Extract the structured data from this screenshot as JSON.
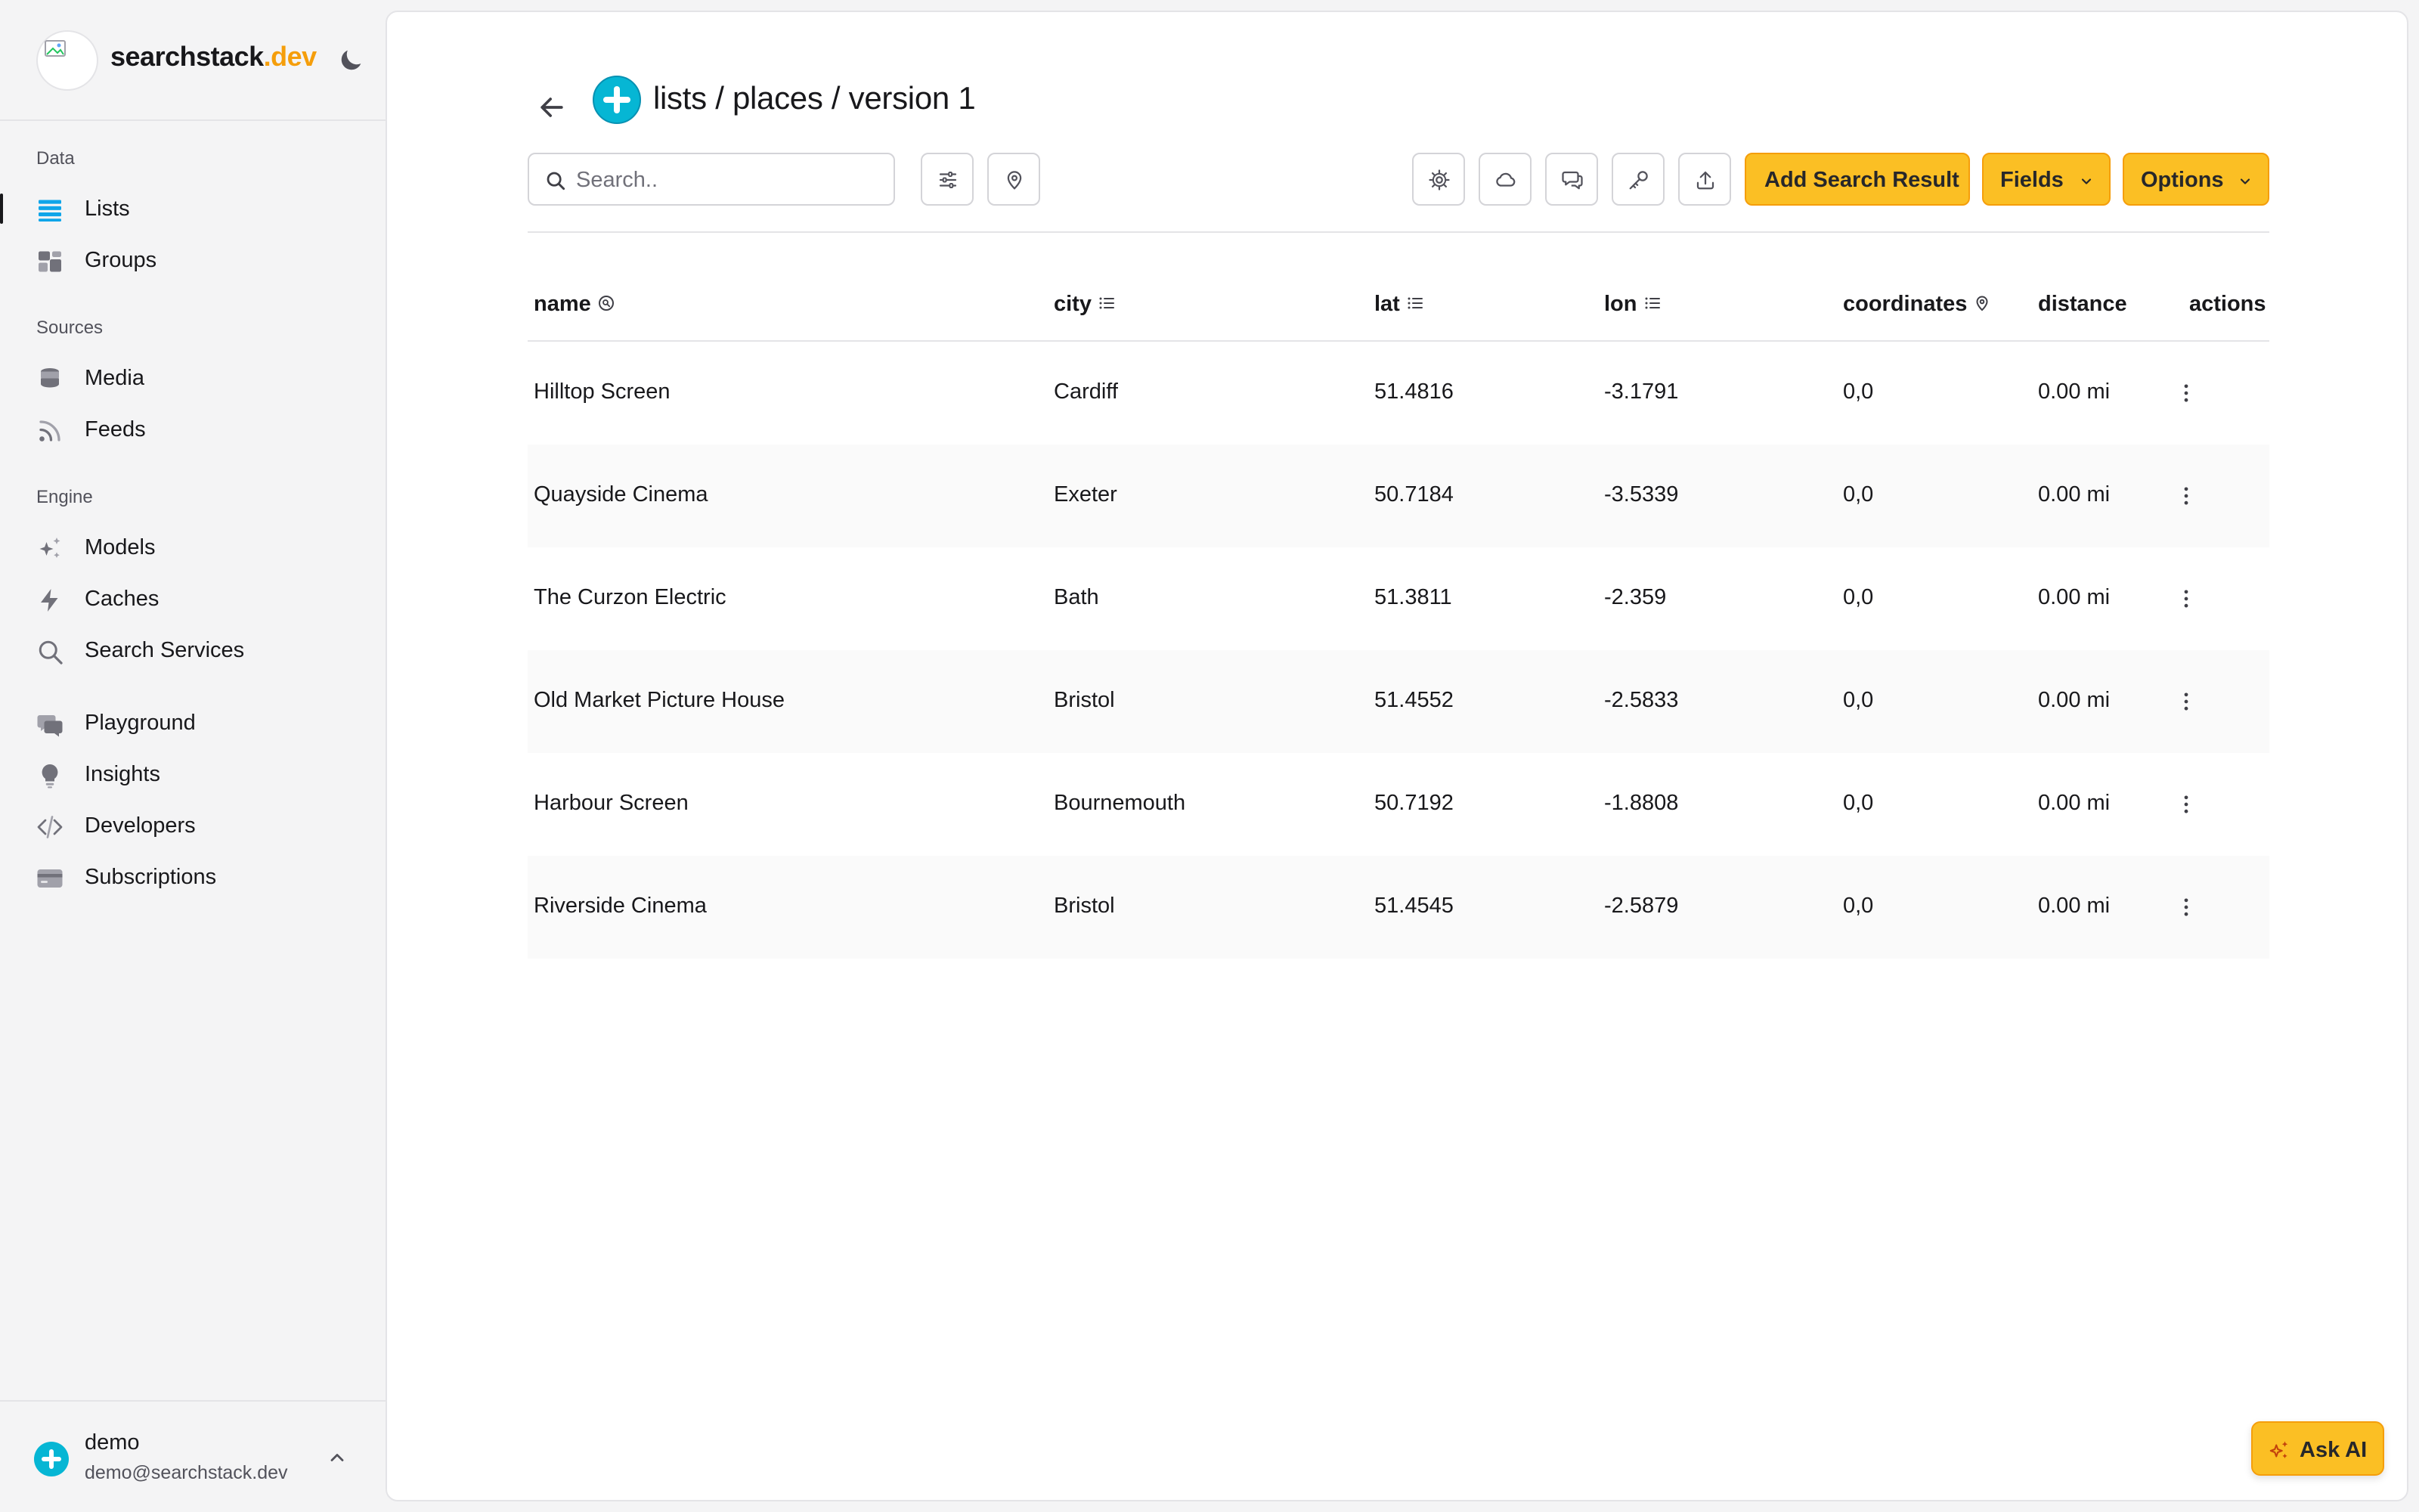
{
  "brand": {
    "name_main": "searchstack",
    "name_suffix": ".dev"
  },
  "sidebar": {
    "sections": [
      {
        "label": "Data",
        "items": [
          {
            "label": "Lists",
            "icon": "list-icon",
            "active": true
          },
          {
            "label": "Groups",
            "icon": "groups-icon"
          }
        ]
      },
      {
        "label": "Sources",
        "items": [
          {
            "label": "Media",
            "icon": "database-icon"
          },
          {
            "label": "Feeds",
            "icon": "rss-icon"
          }
        ]
      },
      {
        "label": "Engine",
        "items": [
          {
            "label": "Models",
            "icon": "sparkles-icon"
          },
          {
            "label": "Caches",
            "icon": "bolt-icon"
          },
          {
            "label": "Search Services",
            "icon": "search-icon"
          }
        ]
      },
      {
        "label": "",
        "items": [
          {
            "label": "Playground",
            "icon": "chat-icon"
          },
          {
            "label": "Insights",
            "icon": "lightbulb-icon"
          },
          {
            "label": "Developers",
            "icon": "code-icon"
          },
          {
            "label": "Subscriptions",
            "icon": "credit-card-icon"
          }
        ]
      }
    ]
  },
  "user": {
    "name": "demo",
    "email": "demo@searchstack.dev"
  },
  "header": {
    "title": "lists / places / version 1"
  },
  "toolbar": {
    "search_placeholder": "Search..",
    "add_label": "Add Search Result",
    "fields_label": "Fields",
    "options_label": "Options"
  },
  "table": {
    "columns": [
      {
        "label": "name",
        "icon": "search-field-icon"
      },
      {
        "label": "city",
        "icon": "list-field-icon"
      },
      {
        "label": "lat",
        "icon": "list-field-icon"
      },
      {
        "label": "lon",
        "icon": "list-field-icon"
      },
      {
        "label": "coordinates",
        "icon": "location-pin-icon"
      },
      {
        "label": "distance"
      },
      {
        "label": "actions"
      }
    ],
    "rows": [
      {
        "name": "Hilltop Screen",
        "city": "Cardiff",
        "lat": "51.4816",
        "lon": "-3.1791",
        "coordinates": "0,0",
        "distance": "0.00 mi"
      },
      {
        "name": "Quayside Cinema",
        "city": "Exeter",
        "lat": "50.7184",
        "lon": "-3.5339",
        "coordinates": "0,0",
        "distance": "0.00 mi"
      },
      {
        "name": "The Curzon Electric",
        "city": "Bath",
        "lat": "51.3811",
        "lon": "-2.359",
        "coordinates": "0,0",
        "distance": "0.00 mi"
      },
      {
        "name": "Old Market Picture House",
        "city": "Bristol",
        "lat": "51.4552",
        "lon": "-2.5833",
        "coordinates": "0,0",
        "distance": "0.00 mi"
      },
      {
        "name": "Harbour Screen",
        "city": "Bournemouth",
        "lat": "50.7192",
        "lon": "-1.8808",
        "coordinates": "0,0",
        "distance": "0.00 mi"
      },
      {
        "name": "Riverside Cinema",
        "city": "Bristol",
        "lat": "51.4545",
        "lon": "-2.5879",
        "coordinates": "0,0",
        "distance": "0.00 mi"
      }
    ]
  },
  "ask_ai": {
    "label": "Ask AI"
  },
  "colors": {
    "accent": "#fbbf24",
    "accent_border": "#f59e0b",
    "brand_suffix": "#f59e0b",
    "logo_blue": "#06b6d4",
    "list_icon": "#0ea5e9"
  }
}
